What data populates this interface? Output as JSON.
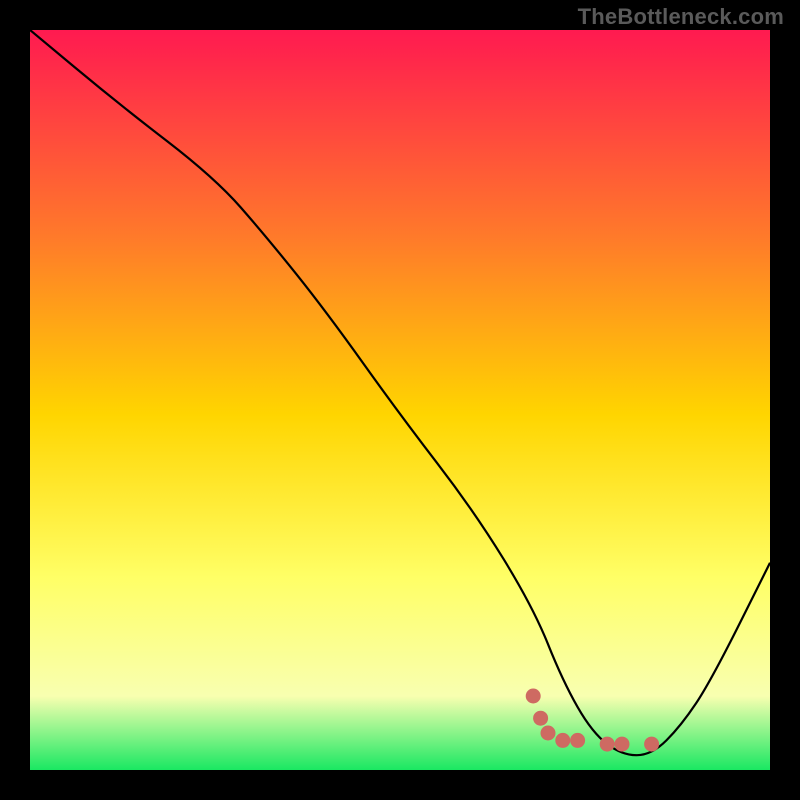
{
  "watermark": "TheBottleneck.com",
  "colors": {
    "background": "#000000",
    "gradient_top": "#ff1a50",
    "gradient_upper_mid": "#ff7a2a",
    "gradient_mid": "#ffd500",
    "gradient_lower_mid": "#ffff66",
    "gradient_low": "#f8ffb0",
    "gradient_bottom": "#19e862",
    "line": "#000000",
    "marker": "#ce6a62"
  },
  "chart_data": {
    "type": "line",
    "title": "",
    "xlabel": "",
    "ylabel": "",
    "xlim": [
      0,
      100
    ],
    "ylim": [
      0,
      100
    ],
    "series": [
      {
        "name": "bottleneck-curve",
        "x": [
          0,
          12,
          25,
          32,
          40,
          50,
          60,
          68,
          72,
          76,
          80,
          84,
          88,
          92,
          100
        ],
        "y": [
          100,
          90,
          80,
          72,
          62,
          48,
          35,
          22,
          12,
          5,
          2,
          2,
          6,
          12,
          28
        ]
      }
    ],
    "markers": [
      {
        "name": "highlight-a",
        "x": 68,
        "y": 10
      },
      {
        "name": "highlight-b",
        "x": 69,
        "y": 7
      },
      {
        "name": "highlight-c",
        "x": 70,
        "y": 5
      },
      {
        "name": "highlight-d",
        "x": 72,
        "y": 4
      },
      {
        "name": "highlight-e",
        "x": 74,
        "y": 4
      },
      {
        "name": "highlight-f",
        "x": 78,
        "y": 3.5
      },
      {
        "name": "highlight-g",
        "x": 80,
        "y": 3.5
      },
      {
        "name": "highlight-h",
        "x": 84,
        "y": 3.5
      }
    ]
  }
}
